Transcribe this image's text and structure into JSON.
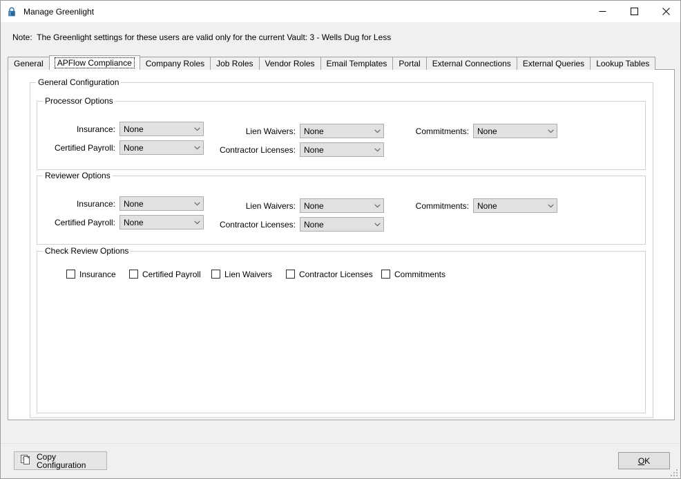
{
  "window": {
    "title": "Manage Greenlight",
    "icon": "lock-icon",
    "controls": {
      "minimize": "—",
      "maximize": "□",
      "close": "✕"
    }
  },
  "note": {
    "text": "Note:  The Greenlight settings for these users are valid only for the current Vault: 3 - Wells Dug for Less"
  },
  "tabs": {
    "selected": "APFlow Compliance",
    "items": [
      {
        "label": "General"
      },
      {
        "label": "APFlow Compliance"
      },
      {
        "label": "Company Roles"
      },
      {
        "label": "Job Roles"
      },
      {
        "label": "Vendor Roles"
      },
      {
        "label": "Email Templates"
      },
      {
        "label": "Portal"
      },
      {
        "label": "External Connections"
      },
      {
        "label": "External Queries"
      },
      {
        "label": "Lookup Tables"
      }
    ]
  },
  "general_configuration": {
    "legend": "General Configuration",
    "processor_options": {
      "legend": "Processor Options",
      "fields": [
        {
          "label": "Insurance:",
          "value": "None"
        },
        {
          "label": "Certified Payroll:",
          "value": "None"
        },
        {
          "label": "Lien Waivers:",
          "value": "None"
        },
        {
          "label": "Contractor Licenses:",
          "value": "None"
        },
        {
          "label": "Commitments:",
          "value": "None"
        }
      ]
    },
    "reviewer_options": {
      "legend": "Reviewer Options",
      "fields": [
        {
          "label": "Insurance:",
          "value": "None"
        },
        {
          "label": "Certified Payroll:",
          "value": "None"
        },
        {
          "label": "Lien Waivers:",
          "value": "None"
        },
        {
          "label": "Contractor Licenses:",
          "value": "None"
        },
        {
          "label": "Commitments:",
          "value": "None"
        }
      ]
    },
    "check_review_options": {
      "legend": "Check Review Options",
      "checkboxes": [
        {
          "label": "Insurance",
          "checked": false
        },
        {
          "label": "Certified Payroll",
          "checked": false
        },
        {
          "label": "Lien Waivers",
          "checked": false
        },
        {
          "label": "Contractor Licenses",
          "checked": false
        },
        {
          "label": "Commitments",
          "checked": false
        }
      ]
    }
  },
  "footer": {
    "copy_configuration_label": "Copy Configuration",
    "ok_accel": "O",
    "ok_rest": "K"
  },
  "colors": {
    "window_background": "#f0f0f0",
    "panel_background": "#ffffff",
    "combo_fill": "#e1e1e1",
    "combo_border": "#acacac",
    "group_border": "#d0d0d0",
    "tab_border": "#a0a0a0",
    "lock_icon": "#2e6da4"
  }
}
